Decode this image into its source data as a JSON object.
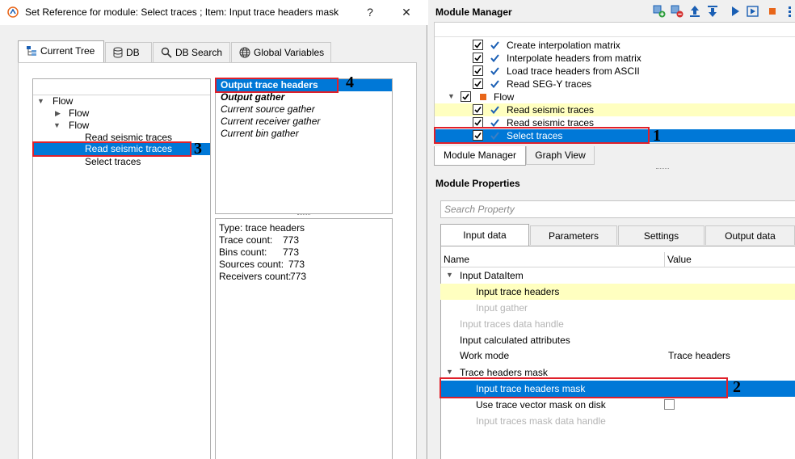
{
  "dialog": {
    "title": "Set Reference for module: Select traces ; Item: Input trace headers mask",
    "help_button": "?",
    "close_button": "✕",
    "tabs": [
      "Current Tree",
      "DB",
      "DB Search",
      "Global Variables"
    ],
    "tree": [
      {
        "label": "Flow"
      },
      {
        "label": "Flow"
      },
      {
        "label": "Flow"
      },
      {
        "label": "Read seismic traces"
      },
      {
        "label": "Read seismic traces"
      },
      {
        "label": "Select traces"
      }
    ],
    "items": [
      "Output trace headers",
      "Output gather",
      "Current source gather",
      "Current receiver gather",
      "Current bin gather"
    ],
    "info": {
      "type": "Type: trace headers",
      "trace_count_label": "Trace count:",
      "trace_count": "773",
      "bins_count_label": "Bins count:",
      "bins_count": "773",
      "sources_count_label": "Sources count:",
      "sources_count": "773",
      "receivers_count_label": "Receivers count:",
      "receivers_count": "773"
    }
  },
  "module_manager": {
    "title": "Module Manager",
    "modules": [
      {
        "label": "Create interpolation matrix",
        "checked": true
      },
      {
        "label": "Interpolate headers from matrix",
        "checked": true
      },
      {
        "label": "Load trace headers from ASCII",
        "checked": true
      },
      {
        "label": "Read SEG-Y traces",
        "checked": true
      },
      {
        "label": "Flow",
        "checked": true
      },
      {
        "label": "Read seismic traces",
        "checked": true
      },
      {
        "label": "Read seismic traces",
        "checked": true
      },
      {
        "label": "Select traces",
        "checked": true
      }
    ],
    "view_tabs": [
      "Module Manager",
      "Graph View"
    ]
  },
  "module_properties": {
    "title": "Module Properties",
    "search_placeholder": "Search Property",
    "tabs": [
      "Input data",
      "Parameters",
      "Settings",
      "Output data"
    ],
    "columns": [
      "Name",
      "Value"
    ],
    "rows": [
      {
        "name": "Input DataItem",
        "value": ""
      },
      {
        "name": "Input trace headers",
        "value": ""
      },
      {
        "name": "Input gather",
        "value": ""
      },
      {
        "name": "Input traces data handle",
        "value": ""
      },
      {
        "name": "Input calculated attributes",
        "value": ""
      },
      {
        "name": "Work mode",
        "value": "Trace headers"
      },
      {
        "name": "Trace headers mask",
        "value": ""
      },
      {
        "name": "Input trace headers mask",
        "value": ""
      },
      {
        "name": "Use trace vector mask on disk",
        "value": ""
      },
      {
        "name": "Input traces mask data handle",
        "value": ""
      }
    ]
  },
  "callouts": [
    "1",
    "2",
    "3",
    "4"
  ],
  "colors": {
    "selection": "#0078d7",
    "highlight_yellow": "#ffffc0",
    "callout_red": "#e0202a",
    "play_blue": "#1a5fb4",
    "stop_orange": "#e8661a"
  }
}
